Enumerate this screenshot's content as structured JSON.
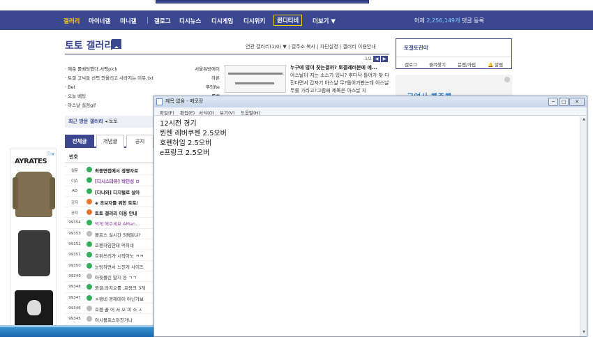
{
  "nav": {
    "items": [
      "갤러리",
      "마이너갤",
      "미니갤",
      "갤로그",
      "디시뉴스",
      "디시게임",
      "디시위키",
      "퀸디티비",
      "더보기 ▼"
    ],
    "count_prefix": "어제",
    "count": "2,256,149개",
    "count_suffix": "댓글 등록"
  },
  "gallery": {
    "title": "토토 갤러리",
    "tools": "연관 갤러리(1/0) ▼  |  갤주소 복사  |  차단설정  |  갤러리 이용안내",
    "pager": "1/2",
    "links": [
      "· 해축 롤베팅했다,서팩pick",
      "· 토갤 고닉들 선픽 안올리고 사라지는 이유.txt",
      "· Bet",
      "· 오늘 베팅",
      "· 아스날 실점gif"
    ],
    "users": [
      "서울특방에이",
      "하론",
      "뿌잉Re",
      "롤백"
    ],
    "news_title": "누구에 많이 찾는결까? 토갤레러분에 예...",
    "news_body": "아스날이 지는 소스가 있나? 후다닥 틀어가 찾 다진다면서 갑자기 아스날 무?틀어가봤는데 아스날 무를 가라고?그럼왜 제목은 아스날 지",
    "recent": "최근 방문 갤러리",
    "recent_item": "토토",
    "tabs": [
      "전체글",
      "개념글",
      "공지"
    ],
    "col_no": "번호",
    "rows": [
      {
        "n": "설문",
        "icon": "#2fae5b",
        "s": "최종면접에서 경쟁자로",
        "style": "bold"
      },
      {
        "n": "이슈",
        "icon": "#2fae5b",
        "s": "[디시스타뷰] 박민성 ㅁ",
        "style": "purple"
      },
      {
        "n": "AD",
        "icon": "#2fae5b",
        "s": "[다나와] 디지털로 살아",
        "style": "bold"
      },
      {
        "n": "공지",
        "icon": "#e8762c",
        "s": "◈ 초보자를 위한 토토/",
        "style": "bold"
      },
      {
        "n": "공지",
        "icon": "#e8762c",
        "s": "토토 갤러리 이용 안내",
        "style": "bold"
      },
      {
        "n": "99354",
        "icon": "#2fae5b",
        "s": "먹게 해주세요 AMan...",
        "style": "link"
      },
      {
        "n": "99353",
        "icon": "#bbbbbb",
        "s": "볼프스 실시간 5배임냐?",
        "style": ""
      },
      {
        "n": "99352",
        "icon": "#2fae5b",
        "s": "호펜하임한테 먹히네",
        "style": ""
      },
      {
        "n": "99351",
        "icon": "#2fae5b",
        "s": "호뒤쓰리가 시작이노 ㅋㅋ",
        "style": ""
      },
      {
        "n": "99350",
        "icon": "#2fae5b",
        "s": "눈팅하면서 느낀게 사이즈",
        "style": ""
      },
      {
        "n": "99349",
        "icon": "#bbbbbb",
        "s": "아뭣플린 말지 응 ㄱㄱ",
        "style": ""
      },
      {
        "n": "99348",
        "icon": "#2fae5b",
        "s": "뮌글,라치오를 ,프랑크 3개",
        "style": ""
      },
      {
        "n": "99347",
        "icon": "#2fae5b",
        "s": "ㅈ됐네 경해데이 아닌가보",
        "style": ""
      },
      {
        "n": "99346",
        "icon": "#bbbbbb",
        "s": "호펜 꿀 어 서 오 미 소 ㅅ",
        "style": ""
      },
      {
        "n": "99345",
        "icon": "#bbbbbb",
        "s": "아시볼프스미친거나",
        "style": ""
      }
    ]
  },
  "right": {
    "box_title": "토갤토린이",
    "box_links": [
      "갤로그",
      "즐겨찾기",
      "문맵/가입",
      "🔔 알림"
    ],
    "ad_text": "구여사 콩주콩"
  },
  "ad": {
    "brand": "AYRATES"
  },
  "notepad": {
    "title": "제목 없음 - 메모장",
    "menu": [
      "파일(F)",
      "편집(E)",
      "서식(O)",
      "보기(V)",
      "도움말(H)"
    ],
    "lines": [
      "12시전 경기",
      "뮌헨 레버쿠젠 2.5오버",
      "호펜하임 2.5오버",
      "e프랑크 2.5오버"
    ]
  }
}
